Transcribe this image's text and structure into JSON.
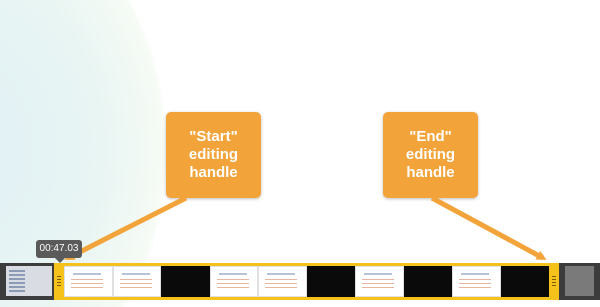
{
  "callouts": {
    "start": "\"Start\"\nediting\nhandle",
    "end": "\"End\"\nediting\nhandle"
  },
  "timeline": {
    "current_time": "00:47.03",
    "frames": [
      "slide",
      "slide",
      "dark",
      "slide",
      "slide",
      "dark",
      "slide",
      "dark",
      "slide",
      "dark"
    ]
  },
  "colors": {
    "callout": "#f2a33a",
    "handle": "#f4c21a",
    "filmstrip": "#3c3c3c",
    "arrow": "#f2a33a"
  }
}
